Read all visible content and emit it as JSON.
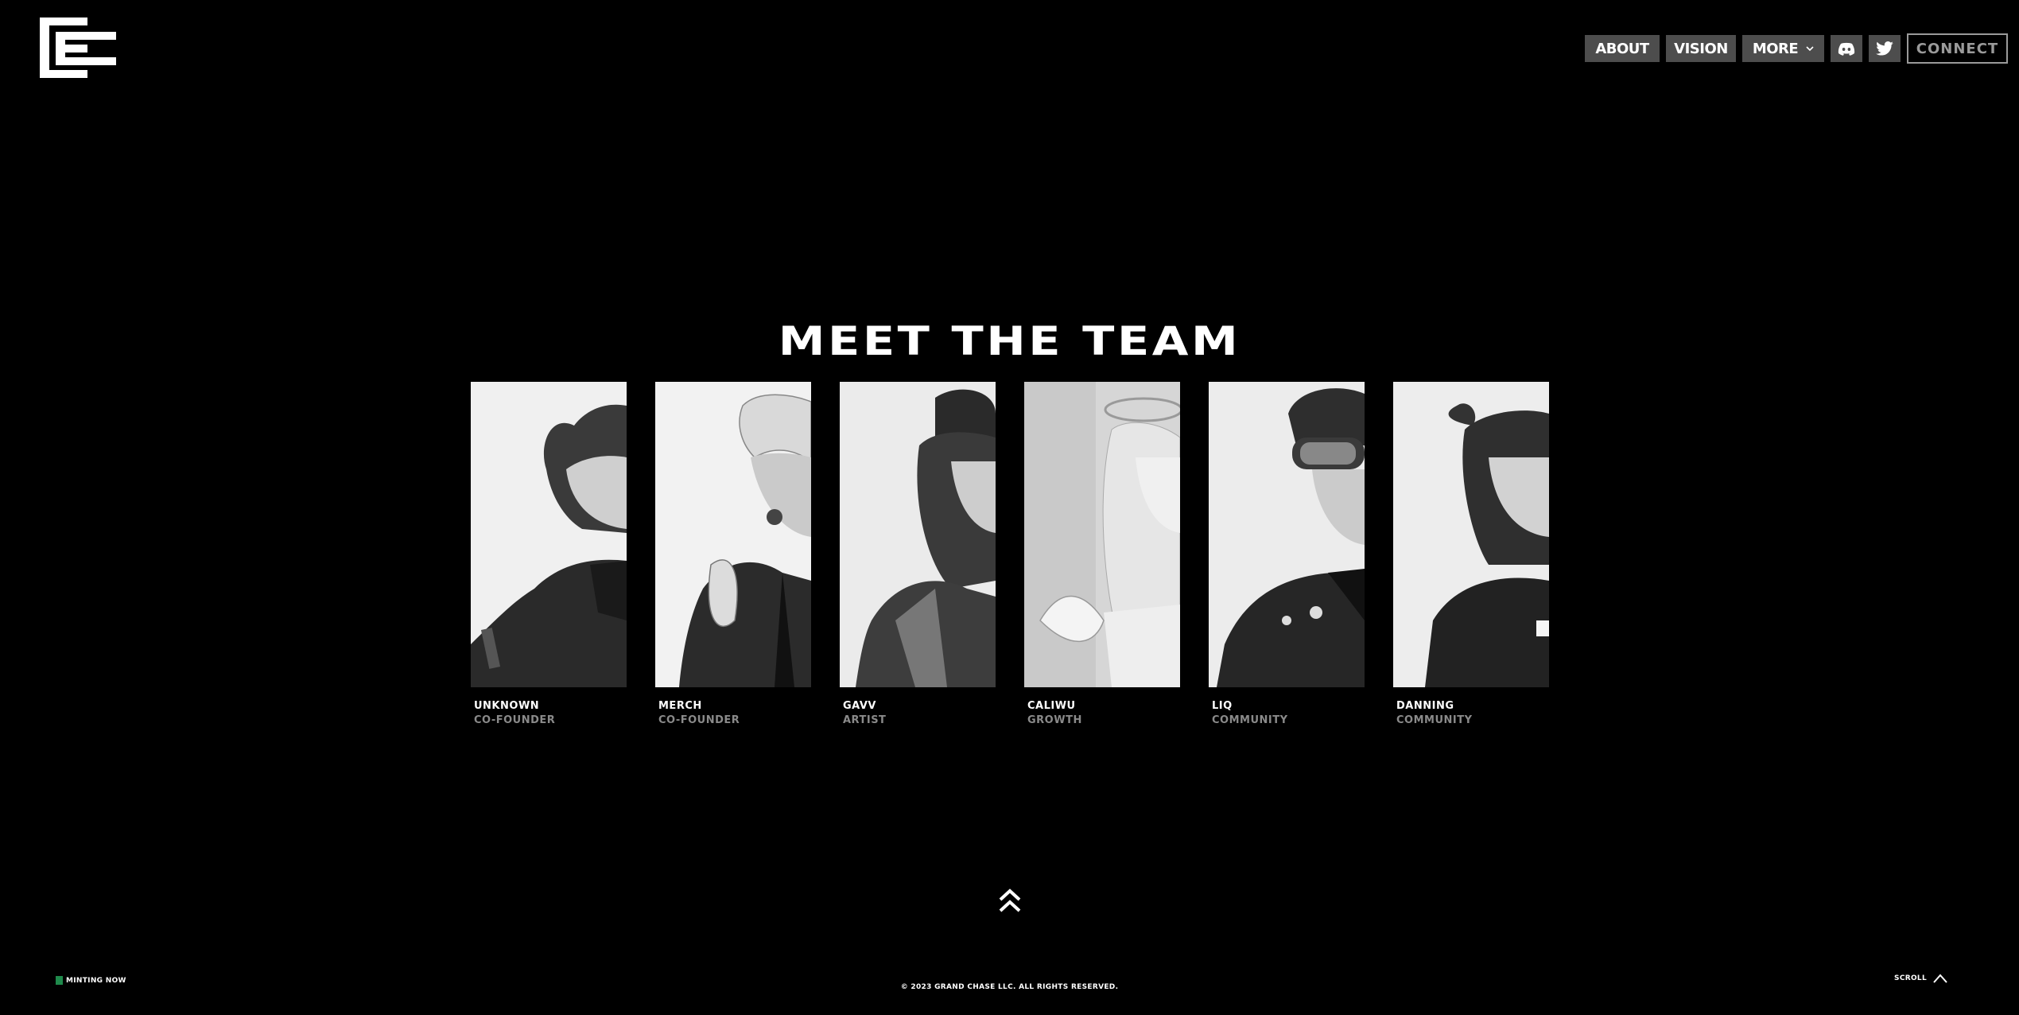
{
  "nav": {
    "about": "ABOUT",
    "vision": "VISION",
    "more": "MORE",
    "connect": "CONNECT",
    "discord_icon": "discord-icon",
    "twitter_icon": "twitter-icon"
  },
  "main": {
    "title": "MEET THE TEAM",
    "team": [
      {
        "name": "UNKNOWN",
        "role": "CO-FOUNDER"
      },
      {
        "name": "MERCH",
        "role": "CO-FOUNDER"
      },
      {
        "name": "GAVV",
        "role": "ARTIST"
      },
      {
        "name": "CALIWU",
        "role": "GROWTH"
      },
      {
        "name": "LIQ",
        "role": "COMMUNITY"
      },
      {
        "name": "DANNING",
        "role": "COMMUNITY"
      }
    ]
  },
  "footer": {
    "status": "MINTING NOW",
    "copyright": "© 2023 GRAND CHASE LLC. ALL RIGHTS RESERVED.",
    "scroll": "SCROLL"
  },
  "colors": {
    "background": "#000000",
    "nav_button": "#4d4d4d",
    "status_dot": "#1f8a4c",
    "muted_text": "#8a8a8a"
  }
}
